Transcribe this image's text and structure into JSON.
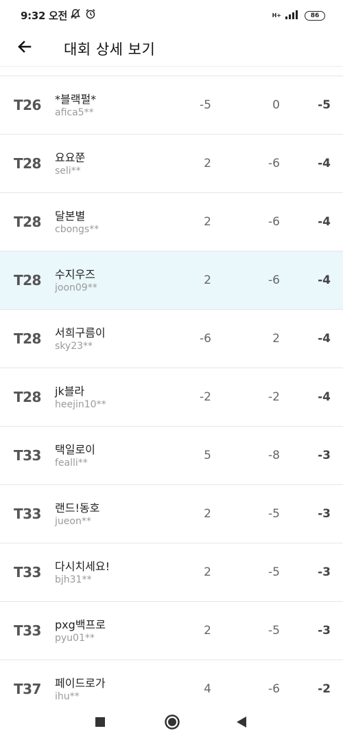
{
  "status": {
    "time": "9:32 오전",
    "network": "H+",
    "battery": "86"
  },
  "header": {
    "title": "대회 상세 보기"
  },
  "rows": [
    {
      "rank": "T26",
      "nickname": "*블랙펄*",
      "user_id": "afica5**",
      "round1": "-5",
      "round2": "0",
      "total": "-5"
    },
    {
      "rank": "T28",
      "nickname": "요요쭌",
      "user_id": "seli**",
      "round1": "2",
      "round2": "-6",
      "total": "-4"
    },
    {
      "rank": "T28",
      "nickname": "달본별",
      "user_id": "cbongs**",
      "round1": "2",
      "round2": "-6",
      "total": "-4"
    },
    {
      "rank": "T28",
      "nickname": "수지우즈",
      "user_id": "joon09**",
      "round1": "2",
      "round2": "-6",
      "total": "-4"
    },
    {
      "rank": "T28",
      "nickname": "서희구름이",
      "user_id": "sky23**",
      "round1": "-6",
      "round2": "2",
      "total": "-4"
    },
    {
      "rank": "T28",
      "nickname": "jk블라",
      "user_id": "heejin10**",
      "round1": "-2",
      "round2": "-2",
      "total": "-4"
    },
    {
      "rank": "T33",
      "nickname": "택일로이",
      "user_id": "fealli**",
      "round1": "5",
      "round2": "-8",
      "total": "-3"
    },
    {
      "rank": "T33",
      "nickname": "랜드!동호",
      "user_id": "jueon**",
      "round1": "2",
      "round2": "-5",
      "total": "-3"
    },
    {
      "rank": "T33",
      "nickname": "다시치세요!",
      "user_id": "bjh31**",
      "round1": "2",
      "round2": "-5",
      "total": "-3"
    },
    {
      "rank": "T33",
      "nickname": "pxg백프로",
      "user_id": "pyu01**",
      "round1": "2",
      "round2": "-5",
      "total": "-3"
    },
    {
      "rank": "T37",
      "nickname": "페이드로가",
      "user_id": "ihu**",
      "round1": "4",
      "round2": "-6",
      "total": "-2"
    }
  ],
  "highlight_color": "#eaf7fb"
}
